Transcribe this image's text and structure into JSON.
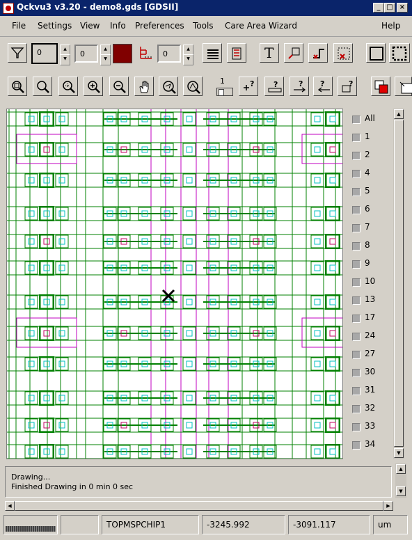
{
  "window": {
    "title": "Qckvu3 v3.20 - demo8.gds [GDSII]"
  },
  "menu": [
    {
      "label": "File"
    },
    {
      "label": "Settings"
    },
    {
      "label": "View"
    },
    {
      "label": "Info"
    },
    {
      "label": "Preferences"
    },
    {
      "label": "Tools"
    },
    {
      "label": "Care Area Wizard"
    },
    {
      "label": "Help"
    }
  ],
  "toolbar1": {
    "filter_icon": "funnel-icon",
    "level_value": "0",
    "depth_value": "0",
    "layer_color": "#800000",
    "hierarchy_value": "0",
    "text_tool_label": "T"
  },
  "toolbar2": {
    "zoom_level": "1"
  },
  "layers": [
    "All",
    "1",
    "2",
    "4",
    "5",
    "6",
    "7",
    "8",
    "9",
    "10",
    "13",
    "17",
    "24",
    "27",
    "30",
    "31",
    "32",
    "33",
    "34"
  ],
  "log": {
    "line1": "Drawing...",
    "line2": "Finished Drawing in 0 min 0 sec"
  },
  "status": {
    "cell": "TOPMSPCHIP1",
    "x": "-3245.992",
    "y": "-3091.117",
    "units": "um"
  },
  "colors": {
    "wire": "#008000",
    "poly": "#c000c0",
    "contact": "#00c0c0",
    "via": "#c00060"
  }
}
